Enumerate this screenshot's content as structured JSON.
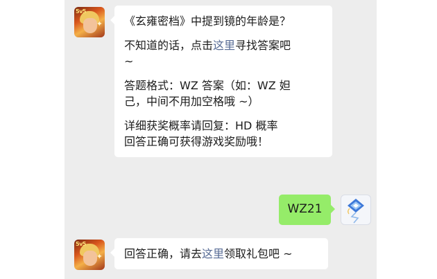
{
  "messages": [
    {
      "sender": "bot",
      "paragraphs": [
        {
          "text": "《玄雍密档》中提到镜的年龄是？"
        },
        {
          "before": "不知道的话，点击",
          "link": "这里",
          "after": "寻找答案吧\n~"
        },
        {
          "text": "答题格式：WZ 答案（如：WZ 妲\n己，中间不用加空格哦 ~）"
        },
        {
          "text": "详细获奖概率请回复：HD 概率\n回答正确可获得游戏奖励哦！"
        }
      ]
    },
    {
      "sender": "user",
      "text": "WZ21"
    },
    {
      "sender": "bot",
      "before": "回答正确，请去",
      "link": "这里",
      "after": "领取礼包吧 ~"
    }
  ],
  "avatars": {
    "bot_badge": "5v5",
    "bot_icon": "game-hero-avatar-icon",
    "user_icon": "kite-logo-avatar-icon"
  },
  "colors": {
    "chat_bg": "#ededed",
    "received_bubble": "#ffffff",
    "sent_bubble": "#95ec69",
    "link": "#576b95"
  }
}
